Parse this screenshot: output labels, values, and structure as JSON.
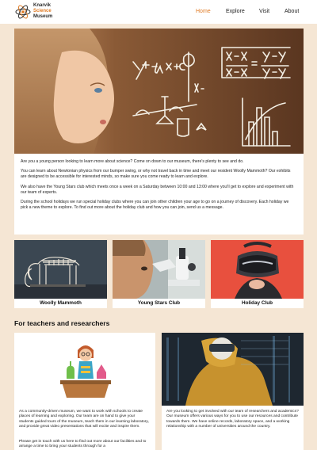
{
  "brand": {
    "line1": "Knarvik",
    "line2": "Science",
    "line3": "Museum"
  },
  "nav": [
    {
      "label": "Home",
      "active": true
    },
    {
      "label": "Explore",
      "active": false
    },
    {
      "label": "Visit",
      "active": false
    },
    {
      "label": "About",
      "active": false
    }
  ],
  "hero": {
    "board_formula": "y=mx+c",
    "board_fraction": "x-x1/x2-x1 = y-y1/y2-y1",
    "board_phi": "phi"
  },
  "intro": {
    "p1": "Are you a young person looking to learn more about science? Come on down to our museum, there's plenty to see and do.",
    "p2": "You can learn about Newtonian physics from our bumper swing, or why not travel back in time and meet our resident Woolly Mammoth? Our exhibits are designed to be accessible for interested minds, so make sure you come ready to learn and explore.",
    "p3": "We also have the Young Stars club which meets once a week on a Saturday between 10:00 and 13:00 where you'll get to explore and experiment with our team of experts.",
    "p4": "During the school holidays we run special holiday clubs where you can join other children your age to go on a journey of discovery. Each holiday we pick a new theme to explore. To find out more about the holiday club and how you can join, send us a message."
  },
  "cards": [
    {
      "caption": "Woolly Mammoth"
    },
    {
      "caption": "Young Stars Club"
    },
    {
      "caption": "Holiday Club"
    }
  ],
  "teachers": {
    "title": "For teachers and researchers",
    "left_p1": "As a community-driven museum, we want to work with schools to create places of learning and exploring. Our team are on hand to give your students guided tours of the museum, teach them in our learning laboratory, and provide great video presentations that will excite and inspire them.",
    "left_p2": "Please get in touch with us here to find out more about our facilities and to arrange a time to bring your students through for a",
    "right_p1": "Are you looking to get involved with our team of researchers and academics? Our museum offers various ways for you to use our resources and contribute towards them. We have online records, laboratory space, and a working relationship with a number of universities around the country."
  },
  "colors": {
    "accent": "#e07b24",
    "page_bg": "#f5e6d4",
    "card_bg": "#ffffff"
  }
}
